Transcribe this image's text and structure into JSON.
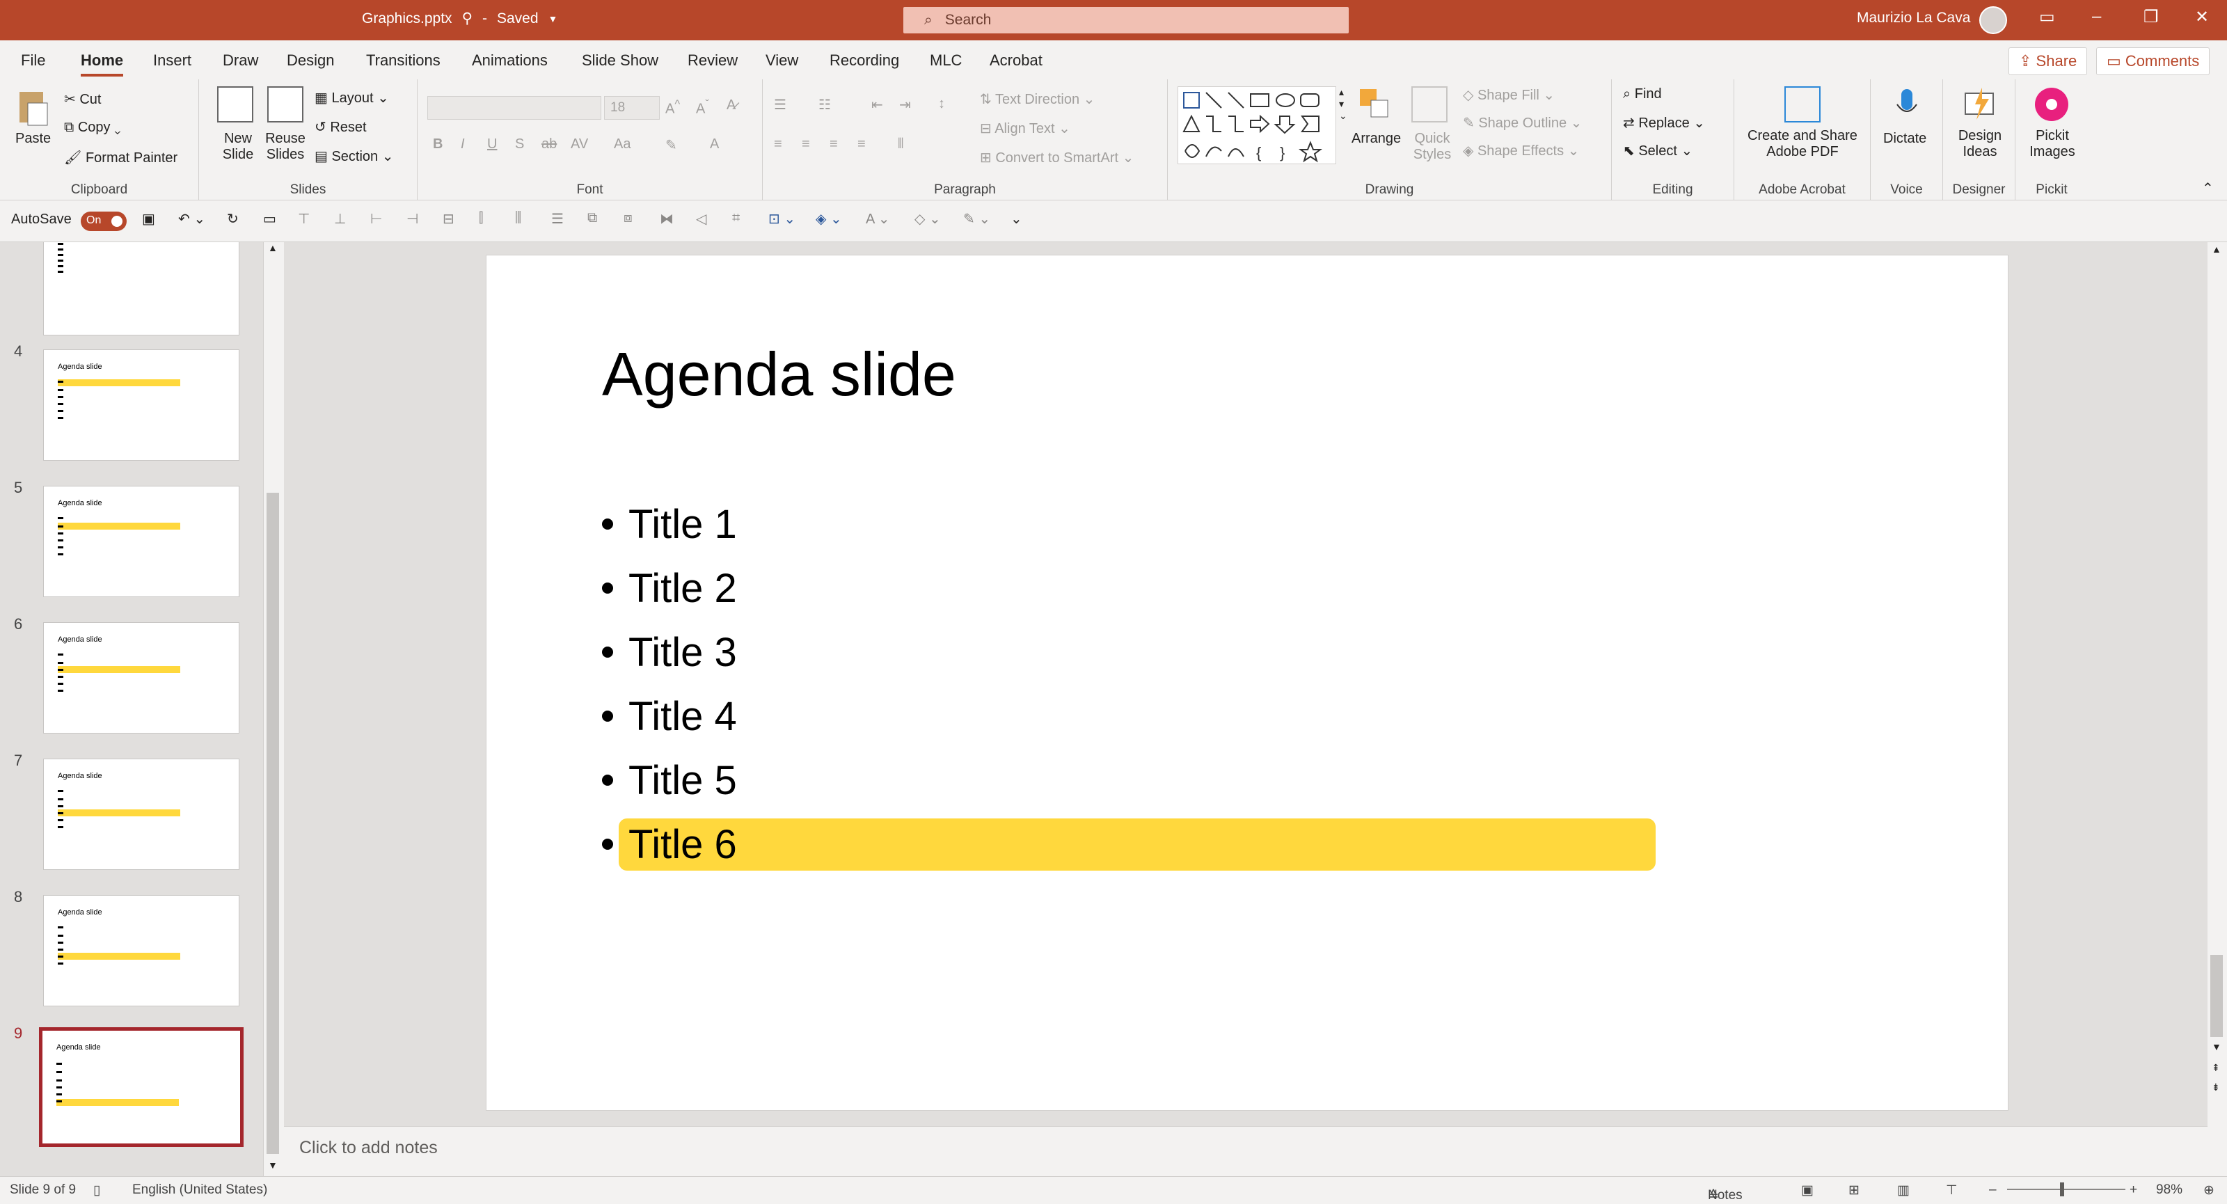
{
  "titlebar": {
    "filename": "Graphics.pptx",
    "saved_status": "Saved",
    "search_placeholder": "Search",
    "user_name": "Maurizio La Cava"
  },
  "tabs": [
    "File",
    "Home",
    "Insert",
    "Draw",
    "Design",
    "Transitions",
    "Animations",
    "Slide Show",
    "Review",
    "View",
    "Recording",
    "MLC",
    "Acrobat"
  ],
  "actions": {
    "share": "Share",
    "comments": "Comments"
  },
  "ribbon": {
    "clipboard": {
      "label": "Clipboard",
      "paste": "Paste",
      "cut": "Cut",
      "copy": "Copy",
      "format_painter": "Format Painter"
    },
    "slides": {
      "label": "Slides",
      "new_slide": "New Slide",
      "reuse_slides": "Reuse Slides",
      "layout": "Layout",
      "reset": "Reset",
      "section": "Section"
    },
    "font": {
      "label": "Font",
      "size": "18"
    },
    "paragraph": {
      "label": "Paragraph",
      "text_direction": "Text Direction",
      "align_text": "Align Text",
      "convert_smartart": "Convert to SmartArt"
    },
    "drawing": {
      "label": "Drawing",
      "arrange": "Arrange",
      "quick_styles": "Quick Styles",
      "shape_fill": "Shape Fill",
      "shape_outline": "Shape Outline",
      "shape_effects": "Shape Effects"
    },
    "editing": {
      "label": "Editing",
      "find": "Find",
      "replace": "Replace",
      "select": "Select"
    },
    "acrobat": {
      "label": "Adobe Acrobat",
      "create_share": "Create and Share Adobe PDF"
    },
    "voice": {
      "label": "Voice",
      "dictate": "Dictate"
    },
    "designer": {
      "label": "Designer",
      "design_ideas": "Design Ideas"
    },
    "pickit": {
      "label": "Pickit",
      "pickit_images": "Pickit Images"
    }
  },
  "qat": {
    "autosave": "AutoSave",
    "toggle": "On"
  },
  "thumbnails": [
    {
      "num": "",
      "title": "",
      "highlight": -1
    },
    {
      "num": "4",
      "title": "Agenda slide",
      "highlight": 0
    },
    {
      "num": "5",
      "title": "Agenda slide",
      "highlight": 1
    },
    {
      "num": "6",
      "title": "Agenda slide",
      "highlight": 2
    },
    {
      "num": "7",
      "title": "Agenda slide",
      "highlight": 3
    },
    {
      "num": "8",
      "title": "Agenda slide",
      "highlight": 4
    },
    {
      "num": "9",
      "title": "Agenda slide",
      "highlight": 5
    }
  ],
  "slide": {
    "title": "Agenda slide",
    "bullets": [
      "Title 1",
      "Title 2",
      "Title 3",
      "Title 4",
      "Title 5",
      "Title 6"
    ],
    "highlight_color": "#ffd83d"
  },
  "notes_placeholder": "Click to add notes",
  "status": {
    "slide_count": "Slide 9 of 9",
    "language": "English (United States)",
    "notes": "Notes",
    "zoom": "98%"
  },
  "colors": {
    "accent": "#b7472a",
    "selection": "#a4262c"
  }
}
